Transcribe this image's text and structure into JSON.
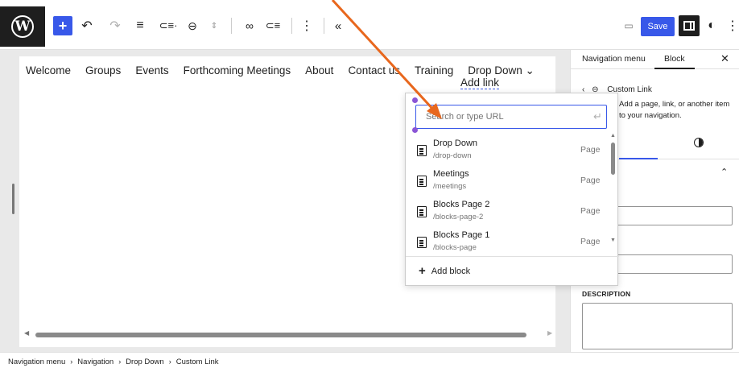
{
  "toolbar": {
    "save_label": "Save",
    "icons": [
      "wordpress-icon",
      "add-block-icon",
      "undo-icon",
      "redo-icon",
      "list-view-icon",
      "navigation-icon",
      "submenu-icon",
      "move-updown-icon",
      "link-icon",
      "list-indent-icon",
      "more-options-icon",
      "collapse-icon",
      "preview-icon",
      "settings-icon",
      "contrast-icon"
    ]
  },
  "nav": {
    "items": [
      "Welcome",
      "Groups",
      "Events",
      "Forthcoming Meetings",
      "About",
      "Contact us",
      "Training",
      "Drop Down ⌄"
    ],
    "add_link": "Add link"
  },
  "popover": {
    "search_placeholder": "Search or type URL",
    "results": [
      {
        "title": "Drop Down",
        "path": "/drop-down",
        "type": "Page"
      },
      {
        "title": "Meetings",
        "path": "/meetings",
        "type": "Page"
      },
      {
        "title": "Blocks Page 2",
        "path": "/blocks-page-2",
        "type": "Page"
      },
      {
        "title": "Blocks Page 1",
        "path": "/blocks-page",
        "type": "Page"
      }
    ],
    "add_block": "Add block"
  },
  "sidebar": {
    "tab_navigation_menu": "Navigation menu",
    "tab_block": "Block",
    "block_title": "Custom Link",
    "block_description": "Add a page, link, or another item to your navigation.",
    "description_label": "DESCRIPTION"
  },
  "footer": {
    "breadcrumb": [
      "Navigation menu",
      "Navigation",
      "Drop Down",
      "Custom Link"
    ]
  },
  "colors": {
    "accent": "#3858e9",
    "annotation_arrow": "#e8671d",
    "selection_dot": "#8a55d6"
  }
}
